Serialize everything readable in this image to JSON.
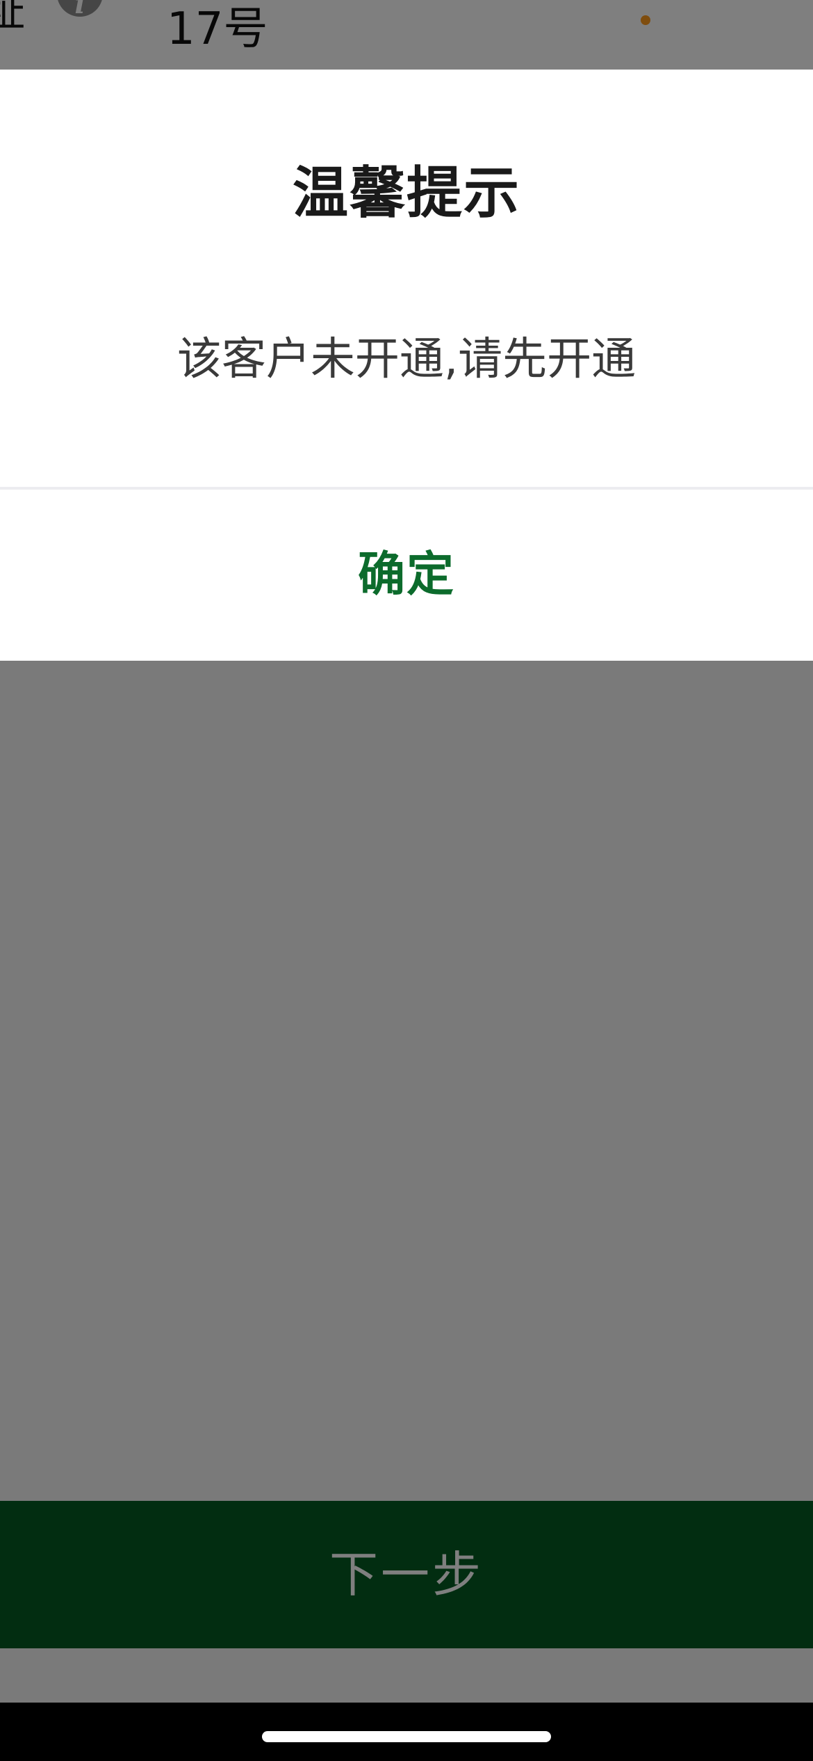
{
  "background_page": {
    "field_label_partial": "址",
    "info_icon": "info-icon",
    "field_value": "17号",
    "next_button_label": "下一步"
  },
  "dialog": {
    "title": "温馨提示",
    "message": "该客户未开通,请先开通",
    "confirm_label": "确定"
  },
  "colors": {
    "primary_green": "#055b22",
    "confirm_text": "#0c6b2c",
    "status_dot": "#ff9a1c",
    "overlay": "rgba(0,0,0,0.5)"
  }
}
